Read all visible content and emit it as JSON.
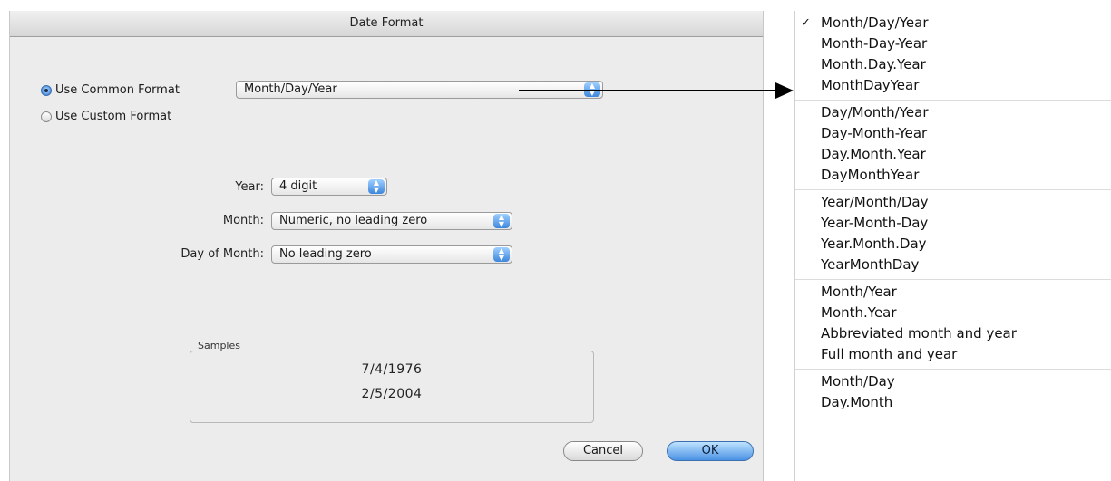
{
  "dialog": {
    "title": "Date Format",
    "use_common_label": "Use Common Format",
    "use_custom_label": "Use Custom Format",
    "common_format_value": "Month/Day/Year",
    "year_label": "Year:",
    "year_value": "4 digit",
    "month_label": "Month:",
    "month_value": "Numeric, no leading zero",
    "day_label": "Day of Month:",
    "day_value": "No leading zero",
    "samples_label": "Samples",
    "samples": [
      "7/4/1976",
      "2/5/2004"
    ],
    "cancel_label": "Cancel",
    "ok_label": "OK"
  },
  "menu": {
    "groups": [
      [
        "Month/Day/Year",
        "Month-Day-Year",
        "Month.Day.Year",
        "MonthDayYear"
      ],
      [
        "Day/Month/Year",
        "Day-Month-Year",
        "Day.Month.Year",
        "DayMonthYear"
      ],
      [
        "Year/Month/Day",
        "Year-Month-Day",
        "Year.Month.Day",
        "YearMonthDay"
      ],
      [
        "Month/Year",
        "Month.Year",
        "Abbreviated month and year",
        "Full month and year"
      ],
      [
        "Month/Day",
        "Day.Month"
      ]
    ],
    "checked_item": "Month/Day/Year",
    "check_glyph": "✓"
  },
  "colors": {
    "accent": "#4a92e4",
    "dialog_bg": "#ececec"
  }
}
